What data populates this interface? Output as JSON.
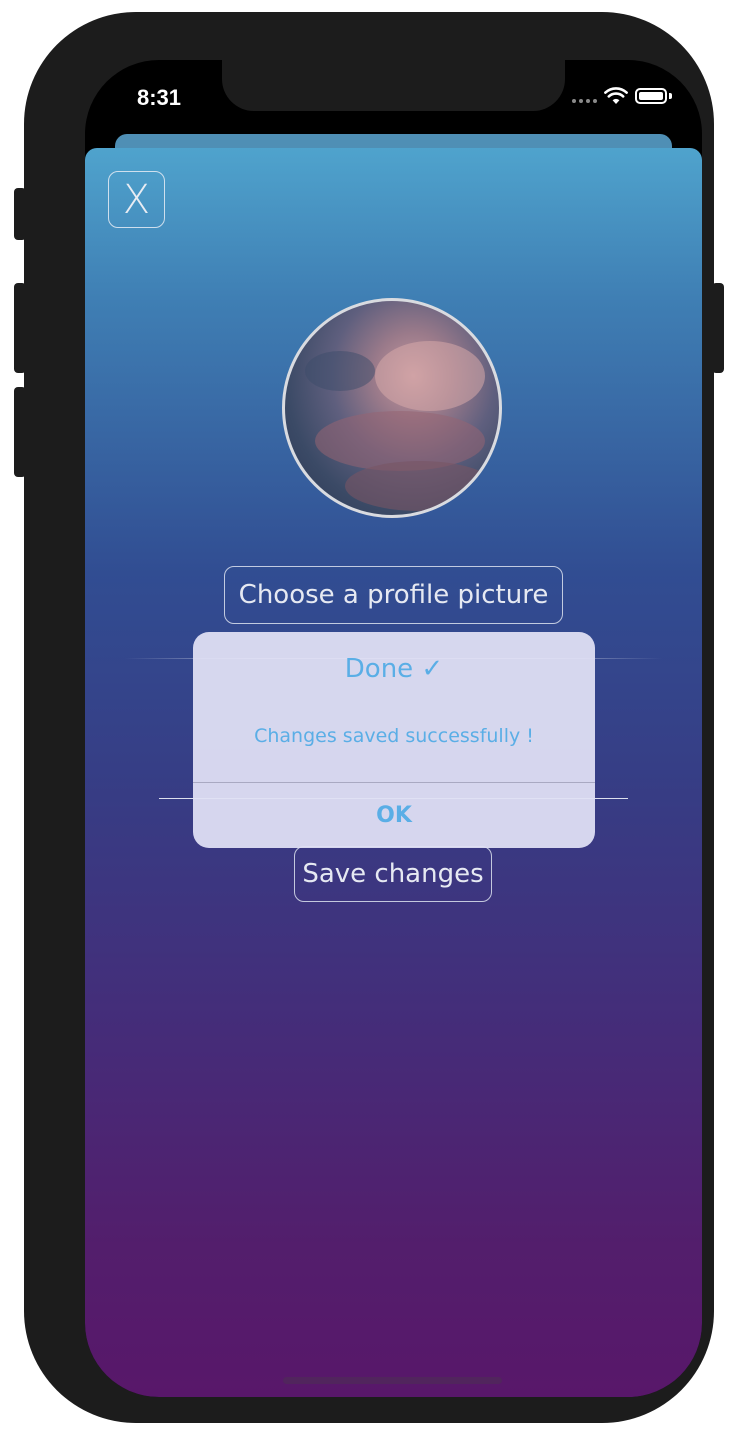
{
  "status_bar": {
    "time": "8:31"
  },
  "profile_screen": {
    "close_label": "X",
    "choose_picture_label": "Choose a profile picture",
    "save_changes_label": "Save changes"
  },
  "alert": {
    "title": "Done ✓",
    "message": "Changes saved successfully !",
    "ok_label": "OK"
  },
  "colors": {
    "alert_text": "#5aaee6",
    "gradient_top": "#4fa3cd",
    "gradient_bottom": "#58176a"
  },
  "icons": {
    "wifi": "wifi-icon",
    "battery": "battery-icon",
    "signal": "signal-icon"
  }
}
